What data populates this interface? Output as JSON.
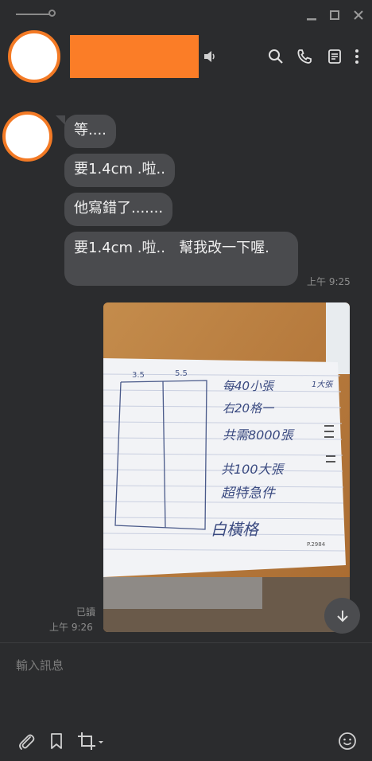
{
  "window": {
    "minimize_icon": "minimize-icon",
    "maximize_icon": "maximize-icon",
    "close_icon": "close-icon"
  },
  "header": {
    "contact_name_redacted": true,
    "speaker_icon": "speaker-icon",
    "actions": [
      "search-icon",
      "phone-icon",
      "notes-icon",
      "more-vertical-icon"
    ]
  },
  "messages": {
    "m1": "等....",
    "m2": "要1.4cm .啦..",
    "m3": "他寫錯了.......",
    "m4": "要1.4cm .啦..   幫我改一下喔.",
    "time1": "上午 9:25",
    "read_status": "已讀",
    "time2": "上午 9:26"
  },
  "photo": {
    "label_left": "3.5",
    "label_right": "5.5",
    "line1": "每40小張",
    "line2": "1大張",
    "line3": "右20格一",
    "line4": "共需8000張",
    "line5": "共100大張",
    "line6": "超特急件",
    "line7": "白橫格",
    "stamp": "P.2984"
  },
  "composer": {
    "placeholder": "輸入訊息",
    "tools": [
      "paperclip-icon",
      "bookmark-icon",
      "crop-icon",
      "emoji-icon"
    ]
  },
  "colors": {
    "background": "#2b2c2e",
    "bubble": "#4a4b4e",
    "accent_orange": "#f37a25"
  }
}
